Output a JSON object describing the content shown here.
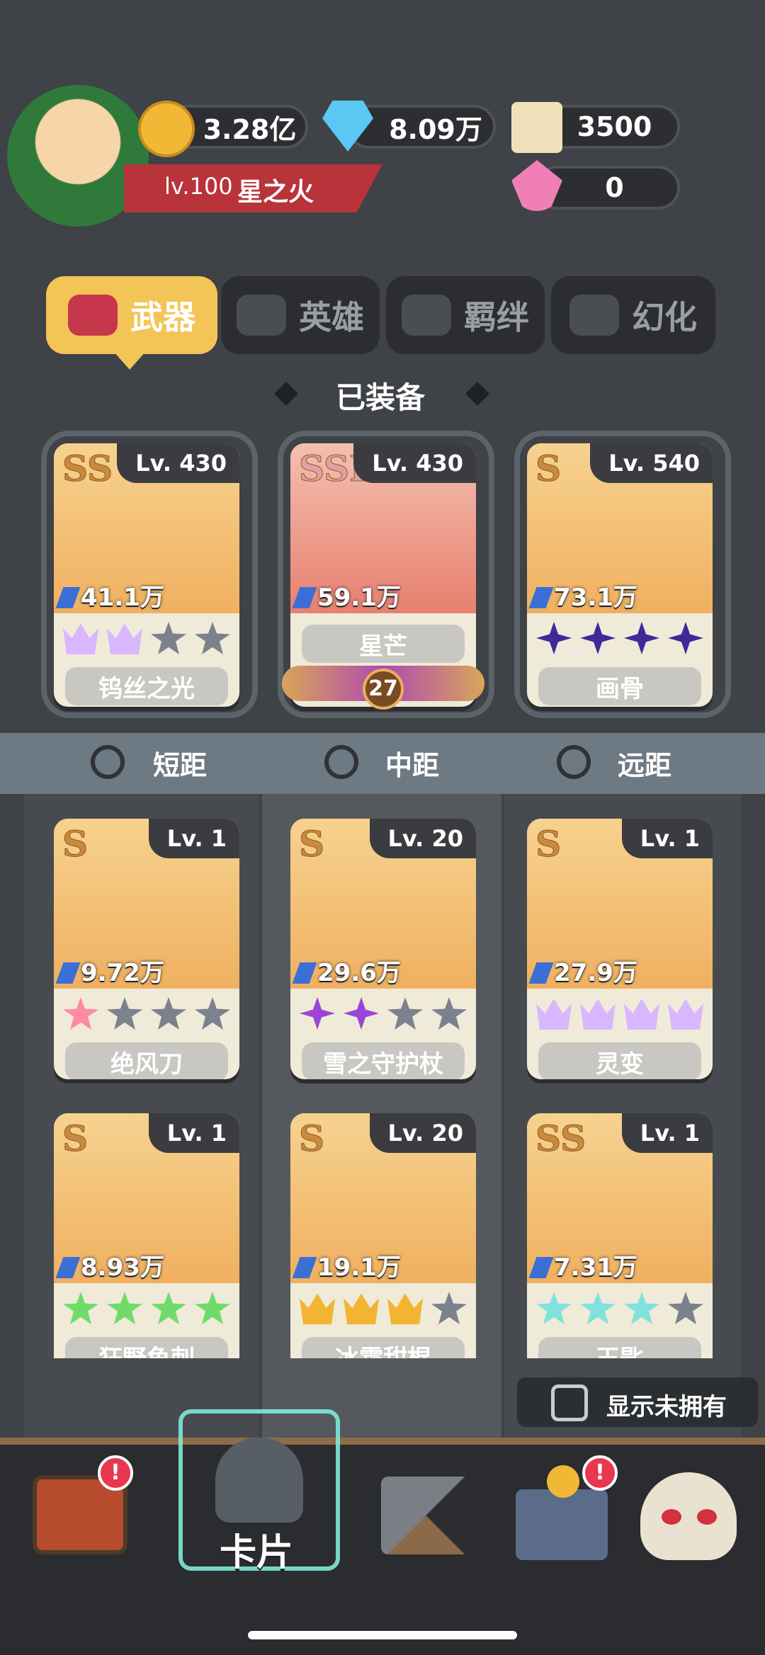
{
  "player": {
    "level": "lv.100",
    "name": "星之火"
  },
  "currencies": {
    "gold": "3.28亿",
    "diamond": "8.09万",
    "scroll": "3500",
    "crystal": "0"
  },
  "tabs": [
    {
      "label": "武器",
      "active": true
    },
    {
      "label": "英雄",
      "active": false
    },
    {
      "label": "羁绊",
      "active": false
    },
    {
      "label": "幻化",
      "active": false
    }
  ],
  "equipped_title": "已装备",
  "equipped": [
    {
      "grade": "SS",
      "level": "Lv. 430",
      "power": "41.1万",
      "name": "钨丝之光",
      "stars": [
        "crown",
        "crown",
        "gray",
        "gray"
      ]
    },
    {
      "grade": "SSR",
      "level": "Lv. 430",
      "power": "59.1万",
      "name": "星芒",
      "badge": "27"
    },
    {
      "grade": "S",
      "level": "Lv. 540",
      "power": "73.1万",
      "name": "画骨",
      "stars": [
        "purple",
        "purple",
        "purple",
        "purple"
      ]
    }
  ],
  "ranges": [
    "短距",
    "中距",
    "远距"
  ],
  "weapons": [
    {
      "grade": "S",
      "level": "Lv. 1",
      "power": "9.72万",
      "name": "绝风刀",
      "stars": [
        "pink",
        "gray",
        "gray",
        "gray"
      ]
    },
    {
      "grade": "S",
      "level": "Lv. 20",
      "power": "29.6万",
      "name": "雪之守护杖",
      "stars": [
        "violet",
        "violet",
        "gray",
        "gray"
      ]
    },
    {
      "grade": "S",
      "level": "Lv. 1",
      "power": "27.9万",
      "name": "灵变",
      "stars": [
        "crown",
        "crown",
        "crown",
        "crown"
      ]
    },
    {
      "grade": "S",
      "level": "Lv. 1",
      "power": "8.93万",
      "name": "狂野鱼刺",
      "stars": [
        "green",
        "green",
        "green",
        "green"
      ]
    },
    {
      "grade": "S",
      "level": "Lv. 20",
      "power": "19.1万",
      "name": "冰霜甜棍",
      "stars": [
        "gold",
        "gold",
        "gold",
        "gray"
      ]
    },
    {
      "grade": "SS",
      "level": "Lv. 1",
      "power": "7.31万",
      "name": "玉匙",
      "stars": [
        "cyan",
        "cyan",
        "cyan",
        "gray"
      ]
    }
  ],
  "show_unowned_label": "显示未拥有",
  "dock": {
    "active_label": "卡片",
    "badges": [
      "!",
      "!"
    ]
  },
  "colors": {
    "accent": "#f3c556",
    "background": "#3f4246"
  }
}
